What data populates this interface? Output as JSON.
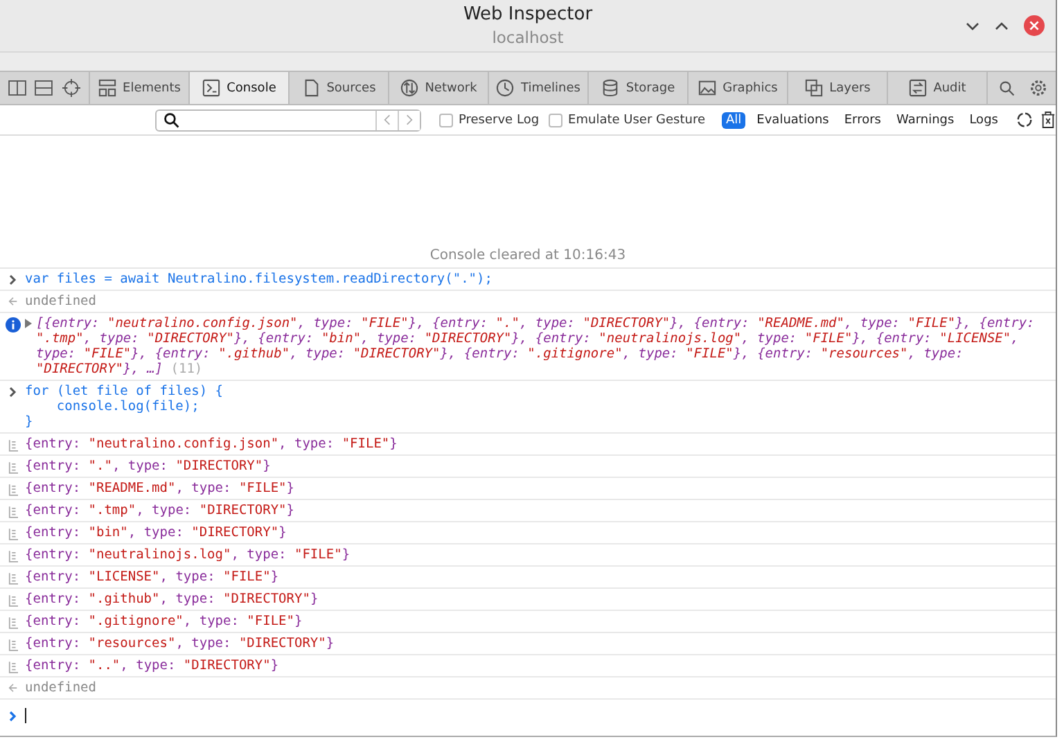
{
  "window": {
    "title": "Web Inspector",
    "subtitle": "localhost"
  },
  "tabs": [
    {
      "label": "Elements",
      "kind": "elements",
      "selected": false
    },
    {
      "label": "Console",
      "kind": "console",
      "selected": true
    },
    {
      "label": "Sources",
      "kind": "sources",
      "selected": false
    },
    {
      "label": "Network",
      "kind": "network",
      "selected": false
    },
    {
      "label": "Timelines",
      "kind": "timelines",
      "selected": false
    },
    {
      "label": "Storage",
      "kind": "storage",
      "selected": false
    },
    {
      "label": "Graphics",
      "kind": "graphics",
      "selected": false
    },
    {
      "label": "Layers",
      "kind": "layers",
      "selected": false
    },
    {
      "label": "Audit",
      "kind": "audit",
      "selected": false
    }
  ],
  "filter_bar": {
    "checkboxes": [
      {
        "label": "Preserve Log",
        "checked": false
      },
      {
        "label": "Emulate User Gesture",
        "checked": false
      }
    ],
    "filters": [
      {
        "label": "All",
        "selected": true
      },
      {
        "label": "Evaluations",
        "selected": false
      },
      {
        "label": "Errors",
        "selected": false
      },
      {
        "label": "Warnings",
        "selected": false
      },
      {
        "label": "Logs",
        "selected": false
      }
    ]
  },
  "console": {
    "cleared_message": "Console cleared at 10:16:43",
    "entries": [
      {
        "kind": "input",
        "lines": [
          "var files = await Neutralino.filesystem.readDirectory(\".\");"
        ]
      },
      {
        "kind": "result",
        "text": "undefined"
      },
      {
        "kind": "info",
        "text": "[{entry: \"neutralino.config.json\", type: \"FILE\"}, {entry: \".\", type: \"DIRECTORY\"}, {entry: \"README.md\", type: \"FILE\"}, {entry: \".tmp\", type: \"DIRECTORY\"}, {entry: \"bin\", type: \"DIRECTORY\"}, {entry: \"neutralinojs.log\", type: \"FILE\"}, {entry: \"LICENSE\", type: \"FILE\"}, {entry: \".github\", type: \"DIRECTORY\"}, {entry: \".gitignore\", type: \"FILE\"}, {entry: \"resources\", type: \"DIRECTORY\"}, …]",
        "count": "(11)"
      },
      {
        "kind": "input",
        "lines": [
          "for (let file of files) {",
          "    console.log(file);",
          "}"
        ]
      },
      {
        "kind": "log",
        "text": "{entry: \"neutralino.config.json\", type: \"FILE\"}"
      },
      {
        "kind": "log",
        "text": "{entry: \".\", type: \"DIRECTORY\"}"
      },
      {
        "kind": "log",
        "text": "{entry: \"README.md\", type: \"FILE\"}"
      },
      {
        "kind": "log",
        "text": "{entry: \".tmp\", type: \"DIRECTORY\"}"
      },
      {
        "kind": "log",
        "text": "{entry: \"bin\", type: \"DIRECTORY\"}"
      },
      {
        "kind": "log",
        "text": "{entry: \"neutralinojs.log\", type: \"FILE\"}"
      },
      {
        "kind": "log",
        "text": "{entry: \"LICENSE\", type: \"FILE\"}"
      },
      {
        "kind": "log",
        "text": "{entry: \".github\", type: \"DIRECTORY\"}"
      },
      {
        "kind": "log",
        "text": "{entry: \".gitignore\", type: \"FILE\"}"
      },
      {
        "kind": "log",
        "text": "{entry: \"resources\", type: \"DIRECTORY\"}"
      },
      {
        "kind": "log",
        "text": "{entry: \"..\", type: \"DIRECTORY\"}"
      },
      {
        "kind": "result",
        "text": "undefined"
      },
      {
        "kind": "prompt"
      }
    ]
  }
}
